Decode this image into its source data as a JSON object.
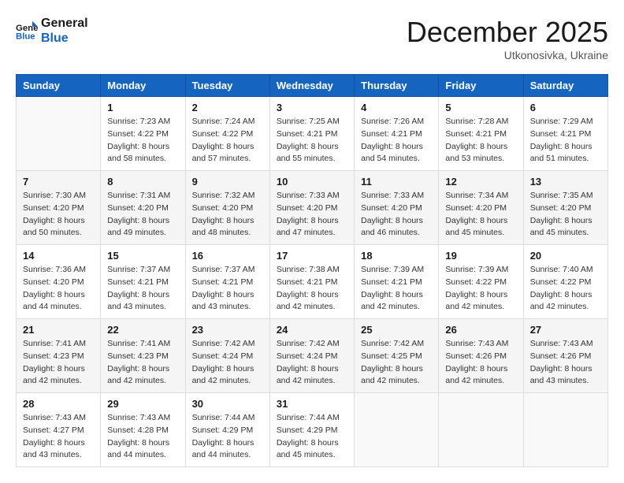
{
  "logo": {
    "text_general": "General",
    "text_blue": "Blue"
  },
  "header": {
    "title": "December 2025",
    "subtitle": "Utkonosivka, Ukraine"
  },
  "weekdays": [
    "Sunday",
    "Monday",
    "Tuesday",
    "Wednesday",
    "Thursday",
    "Friday",
    "Saturday"
  ],
  "weeks": [
    [
      {
        "day": "",
        "sunrise": "",
        "sunset": "",
        "daylight": ""
      },
      {
        "day": "1",
        "sunrise": "Sunrise: 7:23 AM",
        "sunset": "Sunset: 4:22 PM",
        "daylight": "Daylight: 8 hours and 58 minutes."
      },
      {
        "day": "2",
        "sunrise": "Sunrise: 7:24 AM",
        "sunset": "Sunset: 4:22 PM",
        "daylight": "Daylight: 8 hours and 57 minutes."
      },
      {
        "day": "3",
        "sunrise": "Sunrise: 7:25 AM",
        "sunset": "Sunset: 4:21 PM",
        "daylight": "Daylight: 8 hours and 55 minutes."
      },
      {
        "day": "4",
        "sunrise": "Sunrise: 7:26 AM",
        "sunset": "Sunset: 4:21 PM",
        "daylight": "Daylight: 8 hours and 54 minutes."
      },
      {
        "day": "5",
        "sunrise": "Sunrise: 7:28 AM",
        "sunset": "Sunset: 4:21 PM",
        "daylight": "Daylight: 8 hours and 53 minutes."
      },
      {
        "day": "6",
        "sunrise": "Sunrise: 7:29 AM",
        "sunset": "Sunset: 4:21 PM",
        "daylight": "Daylight: 8 hours and 51 minutes."
      }
    ],
    [
      {
        "day": "7",
        "sunrise": "Sunrise: 7:30 AM",
        "sunset": "Sunset: 4:20 PM",
        "daylight": "Daylight: 8 hours and 50 minutes."
      },
      {
        "day": "8",
        "sunrise": "Sunrise: 7:31 AM",
        "sunset": "Sunset: 4:20 PM",
        "daylight": "Daylight: 8 hours and 49 minutes."
      },
      {
        "day": "9",
        "sunrise": "Sunrise: 7:32 AM",
        "sunset": "Sunset: 4:20 PM",
        "daylight": "Daylight: 8 hours and 48 minutes."
      },
      {
        "day": "10",
        "sunrise": "Sunrise: 7:33 AM",
        "sunset": "Sunset: 4:20 PM",
        "daylight": "Daylight: 8 hours and 47 minutes."
      },
      {
        "day": "11",
        "sunrise": "Sunrise: 7:33 AM",
        "sunset": "Sunset: 4:20 PM",
        "daylight": "Daylight: 8 hours and 46 minutes."
      },
      {
        "day": "12",
        "sunrise": "Sunrise: 7:34 AM",
        "sunset": "Sunset: 4:20 PM",
        "daylight": "Daylight: 8 hours and 45 minutes."
      },
      {
        "day": "13",
        "sunrise": "Sunrise: 7:35 AM",
        "sunset": "Sunset: 4:20 PM",
        "daylight": "Daylight: 8 hours and 45 minutes."
      }
    ],
    [
      {
        "day": "14",
        "sunrise": "Sunrise: 7:36 AM",
        "sunset": "Sunset: 4:20 PM",
        "daylight": "Daylight: 8 hours and 44 minutes."
      },
      {
        "day": "15",
        "sunrise": "Sunrise: 7:37 AM",
        "sunset": "Sunset: 4:21 PM",
        "daylight": "Daylight: 8 hours and 43 minutes."
      },
      {
        "day": "16",
        "sunrise": "Sunrise: 7:37 AM",
        "sunset": "Sunset: 4:21 PM",
        "daylight": "Daylight: 8 hours and 43 minutes."
      },
      {
        "day": "17",
        "sunrise": "Sunrise: 7:38 AM",
        "sunset": "Sunset: 4:21 PM",
        "daylight": "Daylight: 8 hours and 42 minutes."
      },
      {
        "day": "18",
        "sunrise": "Sunrise: 7:39 AM",
        "sunset": "Sunset: 4:21 PM",
        "daylight": "Daylight: 8 hours and 42 minutes."
      },
      {
        "day": "19",
        "sunrise": "Sunrise: 7:39 AM",
        "sunset": "Sunset: 4:22 PM",
        "daylight": "Daylight: 8 hours and 42 minutes."
      },
      {
        "day": "20",
        "sunrise": "Sunrise: 7:40 AM",
        "sunset": "Sunset: 4:22 PM",
        "daylight": "Daylight: 8 hours and 42 minutes."
      }
    ],
    [
      {
        "day": "21",
        "sunrise": "Sunrise: 7:41 AM",
        "sunset": "Sunset: 4:23 PM",
        "daylight": "Daylight: 8 hours and 42 minutes."
      },
      {
        "day": "22",
        "sunrise": "Sunrise: 7:41 AM",
        "sunset": "Sunset: 4:23 PM",
        "daylight": "Daylight: 8 hours and 42 minutes."
      },
      {
        "day": "23",
        "sunrise": "Sunrise: 7:42 AM",
        "sunset": "Sunset: 4:24 PM",
        "daylight": "Daylight: 8 hours and 42 minutes."
      },
      {
        "day": "24",
        "sunrise": "Sunrise: 7:42 AM",
        "sunset": "Sunset: 4:24 PM",
        "daylight": "Daylight: 8 hours and 42 minutes."
      },
      {
        "day": "25",
        "sunrise": "Sunrise: 7:42 AM",
        "sunset": "Sunset: 4:25 PM",
        "daylight": "Daylight: 8 hours and 42 minutes."
      },
      {
        "day": "26",
        "sunrise": "Sunrise: 7:43 AM",
        "sunset": "Sunset: 4:26 PM",
        "daylight": "Daylight: 8 hours and 42 minutes."
      },
      {
        "day": "27",
        "sunrise": "Sunrise: 7:43 AM",
        "sunset": "Sunset: 4:26 PM",
        "daylight": "Daylight: 8 hours and 43 minutes."
      }
    ],
    [
      {
        "day": "28",
        "sunrise": "Sunrise: 7:43 AM",
        "sunset": "Sunset: 4:27 PM",
        "daylight": "Daylight: 8 hours and 43 minutes."
      },
      {
        "day": "29",
        "sunrise": "Sunrise: 7:43 AM",
        "sunset": "Sunset: 4:28 PM",
        "daylight": "Daylight: 8 hours and 44 minutes."
      },
      {
        "day": "30",
        "sunrise": "Sunrise: 7:44 AM",
        "sunset": "Sunset: 4:29 PM",
        "daylight": "Daylight: 8 hours and 44 minutes."
      },
      {
        "day": "31",
        "sunrise": "Sunrise: 7:44 AM",
        "sunset": "Sunset: 4:29 PM",
        "daylight": "Daylight: 8 hours and 45 minutes."
      },
      {
        "day": "",
        "sunrise": "",
        "sunset": "",
        "daylight": ""
      },
      {
        "day": "",
        "sunrise": "",
        "sunset": "",
        "daylight": ""
      },
      {
        "day": "",
        "sunrise": "",
        "sunset": "",
        "daylight": ""
      }
    ]
  ]
}
